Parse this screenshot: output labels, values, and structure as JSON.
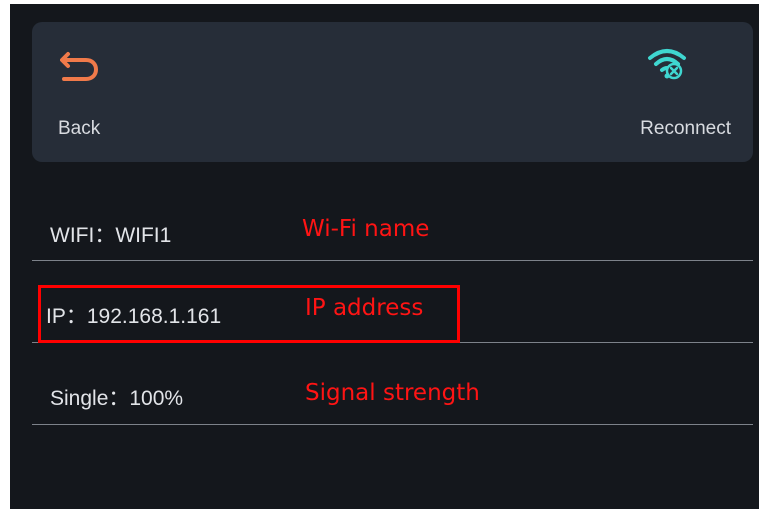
{
  "toolbar": {
    "back_label": "Back",
    "reconnect_label": "Reconnect",
    "back_icon": "back-arrow-icon",
    "reconnect_icon": "wifi-reconnect-icon",
    "icon_color_back": "#f07a4a",
    "icon_color_wifi": "#3fd6d0"
  },
  "info": {
    "wifi": {
      "value": "WIFI：WIFI1",
      "annotation": "Wi-Fi name"
    },
    "ip": {
      "value": "IP：192.168.1.161",
      "annotation": "IP address"
    },
    "signal": {
      "value": "Single：100%",
      "annotation": "Signal strength"
    }
  },
  "colors": {
    "background": "#14171c",
    "toolbar": "#262d38",
    "annotation": "#ff1414",
    "highlight": "#ff0000"
  }
}
